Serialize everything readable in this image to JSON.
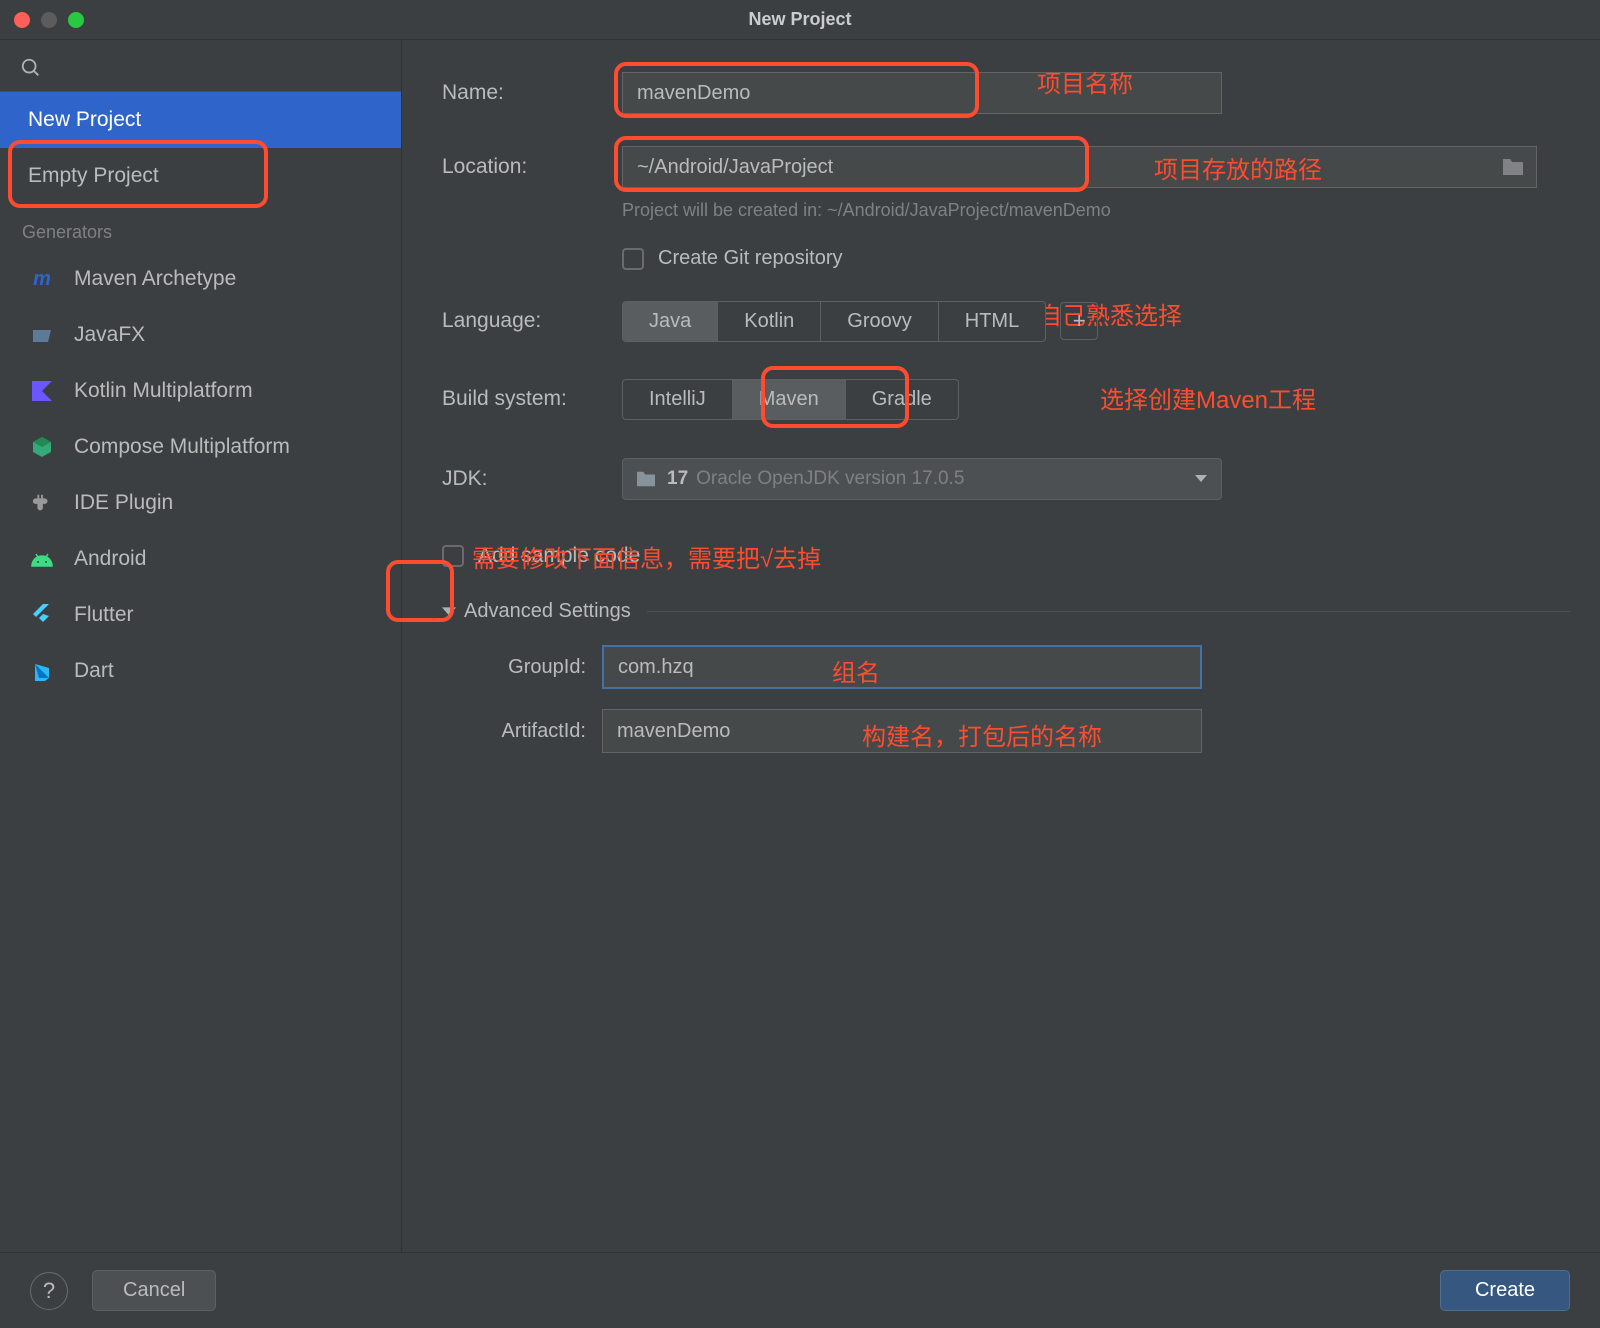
{
  "window": {
    "title": "New Project"
  },
  "sidebar": {
    "items_top": [
      {
        "label": "New Project",
        "selected": true
      },
      {
        "label": "Empty Project",
        "selected": false
      }
    ],
    "generators_heading": "Generators",
    "generators": [
      {
        "label": "Maven Archetype",
        "icon": "maven",
        "color": "#2f65ca"
      },
      {
        "label": "JavaFX",
        "icon": "javafx",
        "color": "#5d7b99"
      },
      {
        "label": "Kotlin Multiplatform",
        "icon": "kotlin",
        "color": "#6b57ff"
      },
      {
        "label": "Compose Multiplatform",
        "icon": "compose",
        "color": "#3a7"
      },
      {
        "label": "IDE Plugin",
        "icon": "ide-plugin",
        "color": "#888"
      },
      {
        "label": "Android",
        "icon": "android",
        "color": "#3ddc84"
      },
      {
        "label": "Flutter",
        "icon": "flutter",
        "color": "#44d1fd"
      },
      {
        "label": "Dart",
        "icon": "dart",
        "color": "#2cb7f6"
      }
    ]
  },
  "form": {
    "name_label": "Name:",
    "name_value": "mavenDemo",
    "location_label": "Location:",
    "location_value": "~/Android/JavaProject",
    "location_hint": "Project will be created in: ~/Android/JavaProject/mavenDemo",
    "git_checkbox_label": "Create Git repository",
    "language_label": "Language:",
    "languages": [
      "Java",
      "Kotlin",
      "Groovy",
      "HTML"
    ],
    "language_selected": "Java",
    "build_label": "Build system:",
    "builds": [
      "IntelliJ",
      "Maven",
      "Gradle"
    ],
    "build_selected": "Maven",
    "jdk_label": "JDK:",
    "jdk_version": "17",
    "jdk_desc": "Oracle OpenJDK version 17.0.5",
    "sample_label": "Add sample code",
    "advanced_label": "Advanced Settings",
    "group_label": "GroupId:",
    "group_value": "com.hzq",
    "artifact_label": "ArtifactId:",
    "artifact_value": "mavenDemo"
  },
  "annotations": {
    "name": "项目名称",
    "location": "项目存放的路径",
    "language": "语言按照自己熟悉选择",
    "build": "选择创建Maven工程",
    "sample": "需要修改下面信息，需要把√去掉",
    "group": "组名",
    "artifact": "构建名，打包后的名称"
  },
  "footer": {
    "help": "?",
    "cancel": "Cancel",
    "create": "Create"
  }
}
